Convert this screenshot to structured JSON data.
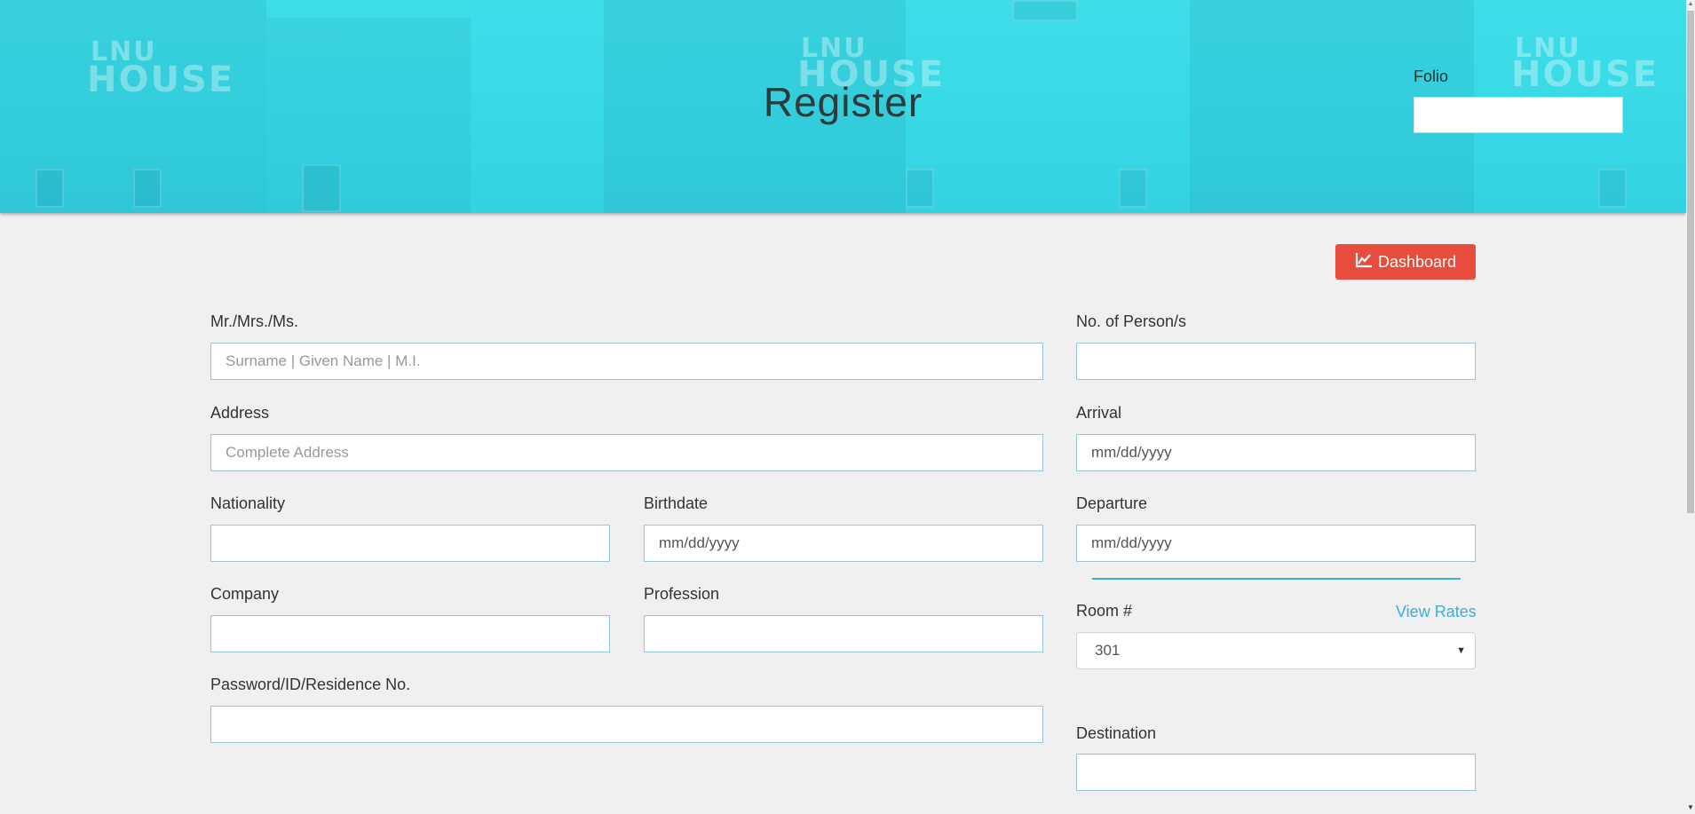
{
  "header": {
    "title": "Register",
    "logo_text_1": "LNU",
    "logo_text_2": "HOUSE",
    "folio_label": "Folio",
    "folio_value": ""
  },
  "toolbar": {
    "dashboard_label": "Dashboard",
    "dashboard_icon": "line-chart-icon",
    "accent_color": "#e74c3c"
  },
  "form": {
    "name": {
      "label": "Mr./Mrs./Ms.",
      "placeholder": "Surname | Given Name | M.I.",
      "value": ""
    },
    "address": {
      "label": "Address",
      "placeholder": "Complete Address",
      "value": ""
    },
    "nationality": {
      "label": "Nationality",
      "value": ""
    },
    "birthdate": {
      "label": "Birthdate",
      "placeholder": "mm/dd/yyyy"
    },
    "company": {
      "label": "Company",
      "value": ""
    },
    "profession": {
      "label": "Profession",
      "value": ""
    },
    "password_id": {
      "label": "Password/ID/Residence No.",
      "value": ""
    },
    "persons": {
      "label": "No. of Person/s",
      "value": ""
    },
    "arrival": {
      "label": "Arrival",
      "placeholder": "mm/dd/yyyy"
    },
    "departure": {
      "label": "Departure",
      "placeholder": "mm/dd/yyyy"
    },
    "room": {
      "label": "Room #",
      "selected": "301",
      "view_rates_label": "View Rates"
    },
    "destination": {
      "label": "Destination",
      "value": ""
    }
  },
  "colors": {
    "banner": "#3fdde8",
    "link": "#3bafda",
    "field_border": "#98c6d8"
  }
}
